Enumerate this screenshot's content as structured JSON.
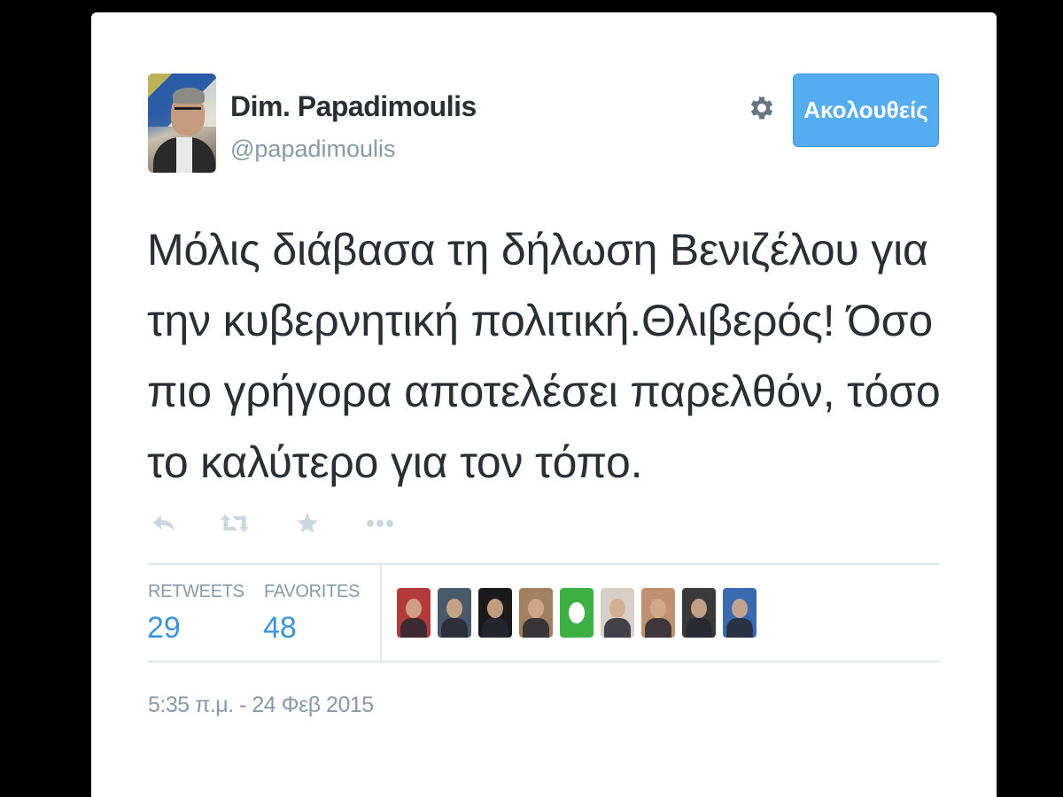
{
  "author": {
    "name": "Dim. Papadimoulis",
    "handle": "@papadimoulis"
  },
  "follow_button": {
    "label": "Ακολουθείς",
    "color": "#55acee"
  },
  "settings_icon": "gear-icon",
  "tweet": {
    "text": "Μόλις διάβασα τη δήλωση Βενιζέλου για την κυβερνητική πολιτική.Θλιβερός! Όσο πιο γρήγορα αποτελέσει παρελθόν, τόσο το καλύτερο για τον τόπο."
  },
  "actions": [
    {
      "name": "reply-icon"
    },
    {
      "name": "retweet-icon"
    },
    {
      "name": "favorite-icon"
    },
    {
      "name": "more-icon"
    }
  ],
  "stats": {
    "retweets_label": "RETWEETS",
    "retweets_count": "29",
    "favorites_label": "FAVORITES",
    "favorites_count": "48"
  },
  "favoriter_avatars": [
    {
      "color": "#b33a3a"
    },
    {
      "color": "#4a5a6a"
    },
    {
      "color": "#1a1a1a"
    },
    {
      "color": "#a08060"
    },
    {
      "color": "#3cb043"
    },
    {
      "color": "#d8d0c8"
    },
    {
      "color": "#c09070"
    },
    {
      "color": "#3a3a3a"
    },
    {
      "color": "#3a6ab0"
    }
  ],
  "timestamp": "5:35 π.μ. - 24 Φεβ 2015",
  "colors": {
    "background": "#000000",
    "card": "#ffffff",
    "text": "#292f33",
    "muted": "#8899a6",
    "link": "#3b94d9"
  }
}
